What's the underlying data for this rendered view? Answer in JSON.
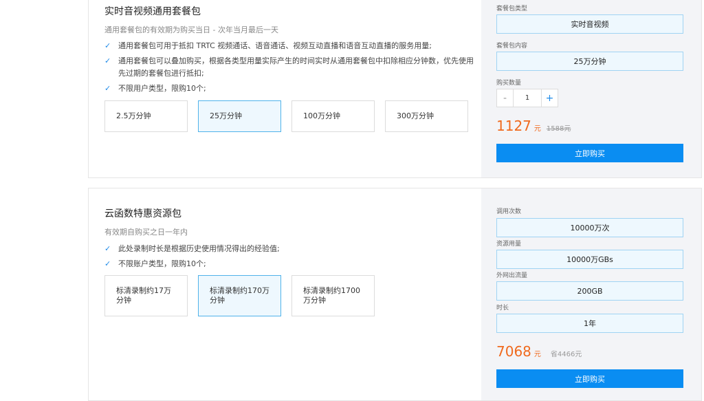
{
  "package1": {
    "title": "实时音视频通用套餐包",
    "subtitle": "通用套餐包的有效期为购买当日 - 次年当月最后一天",
    "features": [
      "通用套餐包可用于抵扣 TRTC 视频通话、语音通话、视频互动直播和语音互动直播的服务用量;",
      "通用套餐包可以叠加购买，根据各类型用量实际产生的时间实时从通用套餐包中扣除相应分钟数，优先使用先过期的套餐包进行抵扣;",
      "不限用户类型，限购10个;"
    ],
    "options": [
      "2.5万分钟",
      "25万分钟",
      "100万分钟",
      "300万分钟"
    ],
    "selected_option": "25万分钟",
    "type_label": "套餐包类型",
    "type_value": "实时音视频",
    "content_label": "套餐包内容",
    "content_value": "25万分钟",
    "qty_label": "购买数量",
    "minus": "-",
    "qty": "1",
    "plus": "+",
    "price": "1127",
    "unit": "元",
    "old_price": "1588元",
    "buy": "立即购买"
  },
  "package2": {
    "title": "云函数特惠资源包",
    "subtitle": "有效期自购买之日一年内",
    "features": [
      "此处录制时长是根据历史使用情况得出的经验值;",
      "不限账户类型，限购10个;"
    ],
    "options": [
      "标清录制约17万分钟",
      "标清录制约170万分钟",
      "标清录制约1700万分钟"
    ],
    "selected_option": "标清录制约170万分钟",
    "calls_label": "调用次数",
    "calls_value": "10000万次",
    "usage_label": "资源用量",
    "usage_value": "10000万GBs",
    "traffic_label": "外网出流量",
    "traffic_value": "200GB",
    "duration_label": "时长",
    "duration_value": "1年",
    "price": "7068",
    "unit": "元",
    "save": "省4466元",
    "buy": "立即购买"
  },
  "colors": {
    "accent": "#0a8df2",
    "price": "#f06a1e",
    "selected_bg": "#eef8fe",
    "selected_border": "#4fb2ea"
  },
  "icons": {
    "check": "check-icon"
  }
}
